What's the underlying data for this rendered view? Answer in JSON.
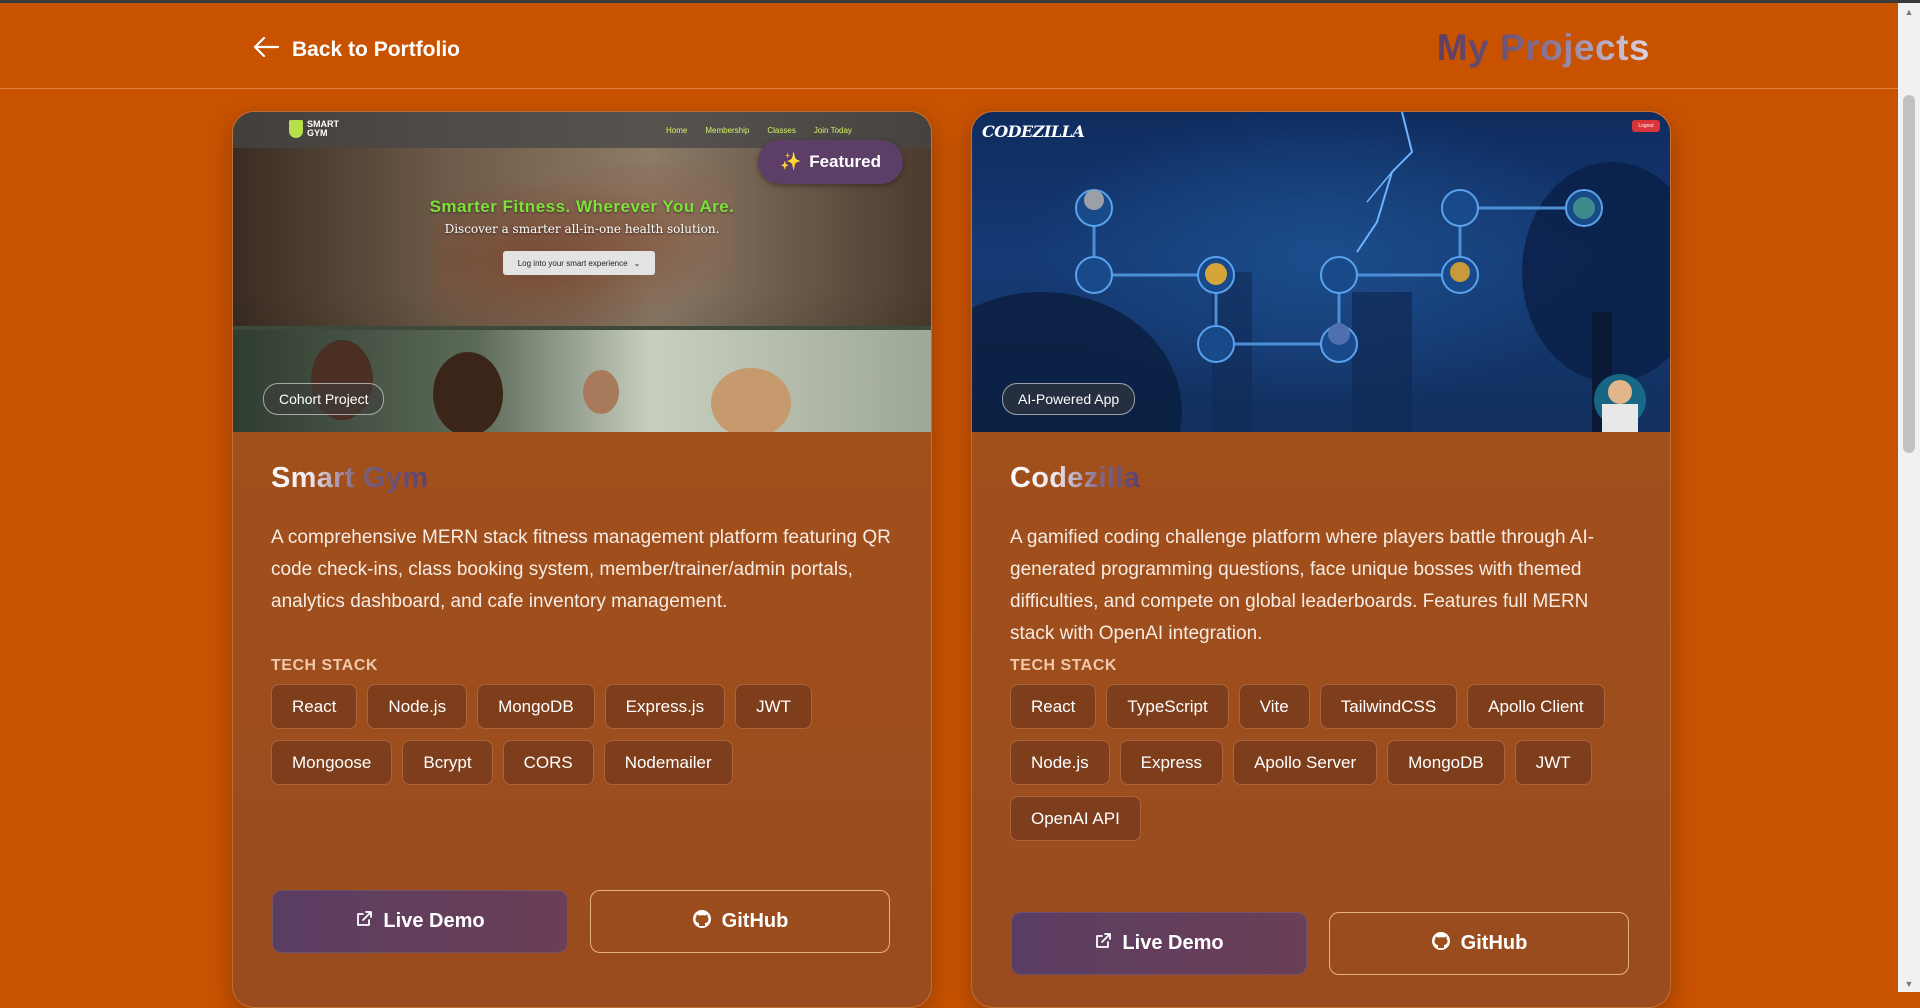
{
  "header": {
    "back_label": "Back to Portfolio",
    "page_title": "My Projects"
  },
  "projects": [
    {
      "title": "Smart Gym",
      "badge": "Featured",
      "featured_icon": "sparkles-icon",
      "category": "Cohort Project",
      "description": "A comprehensive MERN stack fitness management platform featuring QR code check-ins, class booking system, member/trainer/admin portals, analytics dashboard, and cafe inventory management.",
      "tech_label": "TECH STACK",
      "tech": [
        "React",
        "Node.js",
        "MongoDB",
        "Express.js",
        "JWT",
        "Mongoose",
        "Bcrypt",
        "CORS",
        "Nodemailer"
      ],
      "live_label": "Live Demo",
      "github_label": "GitHub",
      "screenshot": {
        "logo_text": "SMART GYM",
        "nav": [
          "Home",
          "Membership",
          "Classes",
          "Join Today"
        ],
        "headline": "Smarter Fitness. Wherever You Are.",
        "subheadline": "Discover a smarter all-in-one health solution.",
        "cta": "Log into your smart experience"
      }
    },
    {
      "title": "Codezilla",
      "category": "AI-Powered App",
      "description": "A gamified coding challenge platform where players battle through AI-generated programming questions, face unique bosses with themed difficulties, and compete on global leaderboards. Features full MERN stack with OpenAI integration.",
      "tech_label": "TECH STACK",
      "tech": [
        "React",
        "TypeScript",
        "Vite",
        "TailwindCSS",
        "Apollo Client",
        "Node.js",
        "Express",
        "Apollo Server",
        "MongoDB",
        "JWT",
        "OpenAI API"
      ],
      "live_label": "Live Demo",
      "github_label": "GitHub",
      "screenshot": {
        "logo_text": "CODEZILLA",
        "logout": "Logout"
      }
    }
  ],
  "colors": {
    "background": "#c85200",
    "card": "#a3511b",
    "live_button": "#5a3d63",
    "accent_green": "#7ee03a"
  }
}
